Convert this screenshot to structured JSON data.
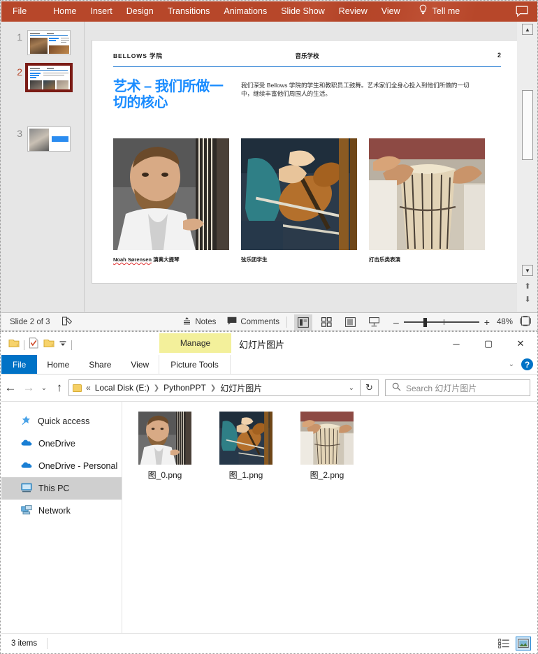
{
  "powerpoint": {
    "ribbon_tabs": [
      {
        "label": "File",
        "name": "ribbon-tab-file"
      },
      {
        "label": "Home",
        "name": "ribbon-tab-home"
      },
      {
        "label": "Insert",
        "name": "ribbon-tab-insert"
      },
      {
        "label": "Design",
        "name": "ribbon-tab-design"
      },
      {
        "label": "Transitions",
        "name": "ribbon-tab-transitions"
      },
      {
        "label": "Animations",
        "name": "ribbon-tab-animations"
      },
      {
        "label": "Slide Show",
        "name": "ribbon-tab-slide-show"
      },
      {
        "label": "Review",
        "name": "ribbon-tab-review"
      },
      {
        "label": "View",
        "name": "ribbon-tab-view"
      }
    ],
    "tell_me": "Tell me",
    "accent_color": "#b7472a",
    "thumbnails": [
      {
        "number": "1",
        "active": false
      },
      {
        "number": "2",
        "active": true
      },
      {
        "number": "3",
        "active": false
      }
    ],
    "slide": {
      "header_left": "BELLOWS 学院",
      "header_center": "音乐学校",
      "header_right": "2",
      "title": "艺术 – 我们所做一切的核心",
      "title_color": "#1a8cff",
      "paragraph": "我们深受 Bellows 学院的学生和教职员工鼓舞。艺术家们全身心投入到他们所做的一切中，继续丰富他们周围人的生活。",
      "photos": [
        {
          "caption_name": "Noah Sørensen",
          "caption_rest": " 演奏大提琴"
        },
        {
          "caption_name": "",
          "caption_rest": "弦乐团学生"
        },
        {
          "caption_name": "",
          "caption_rest": "打击乐类表演"
        }
      ]
    },
    "status": {
      "slide_indicator": "Slide 2 of 3",
      "notes_label": "Notes",
      "comments_label": "Comments",
      "zoom_level": "48%",
      "zoom_minus": "–",
      "zoom_plus": "+"
    }
  },
  "explorer": {
    "title": "幻灯片图片",
    "manage_tab": "Manage",
    "picture_tools": "Picture Tools",
    "ribbon_tabs": [
      {
        "label": "File",
        "name": "explorer-tab-file"
      },
      {
        "label": "Home",
        "name": "explorer-tab-home"
      },
      {
        "label": "Share",
        "name": "explorer-tab-share"
      },
      {
        "label": "View",
        "name": "explorer-tab-view"
      }
    ],
    "window_buttons": {
      "minimize": "─",
      "maximize": "▢",
      "close": "✕"
    },
    "help_icon_label": "?",
    "address": {
      "chevrons": "«",
      "crumbs": [
        "Local Disk (E:)",
        "PythonPPT",
        "幻灯片图片"
      ],
      "refresh_icon": "↻",
      "dropdown_icon": "⌄"
    },
    "search": {
      "placeholder": "Search 幻灯片图片",
      "icon": "search-icon"
    },
    "nav_items": [
      {
        "label": "Quick access",
        "icon": "star-pin-icon",
        "selected": false
      },
      {
        "label": "OneDrive",
        "icon": "cloud-icon",
        "selected": false
      },
      {
        "label": "OneDrive - Personal",
        "icon": "cloud-icon",
        "selected": false
      },
      {
        "label": "This PC",
        "icon": "monitor-icon",
        "selected": true
      },
      {
        "label": "Network",
        "icon": "network-icon",
        "selected": false
      }
    ],
    "files": [
      {
        "name": "图_0.png"
      },
      {
        "name": "图_1.png"
      },
      {
        "name": "图_2.png"
      }
    ],
    "status": {
      "item_count": "3 items",
      "view_details": "details-view-icon",
      "view_large_icons": "large-icons-view-icon"
    }
  }
}
